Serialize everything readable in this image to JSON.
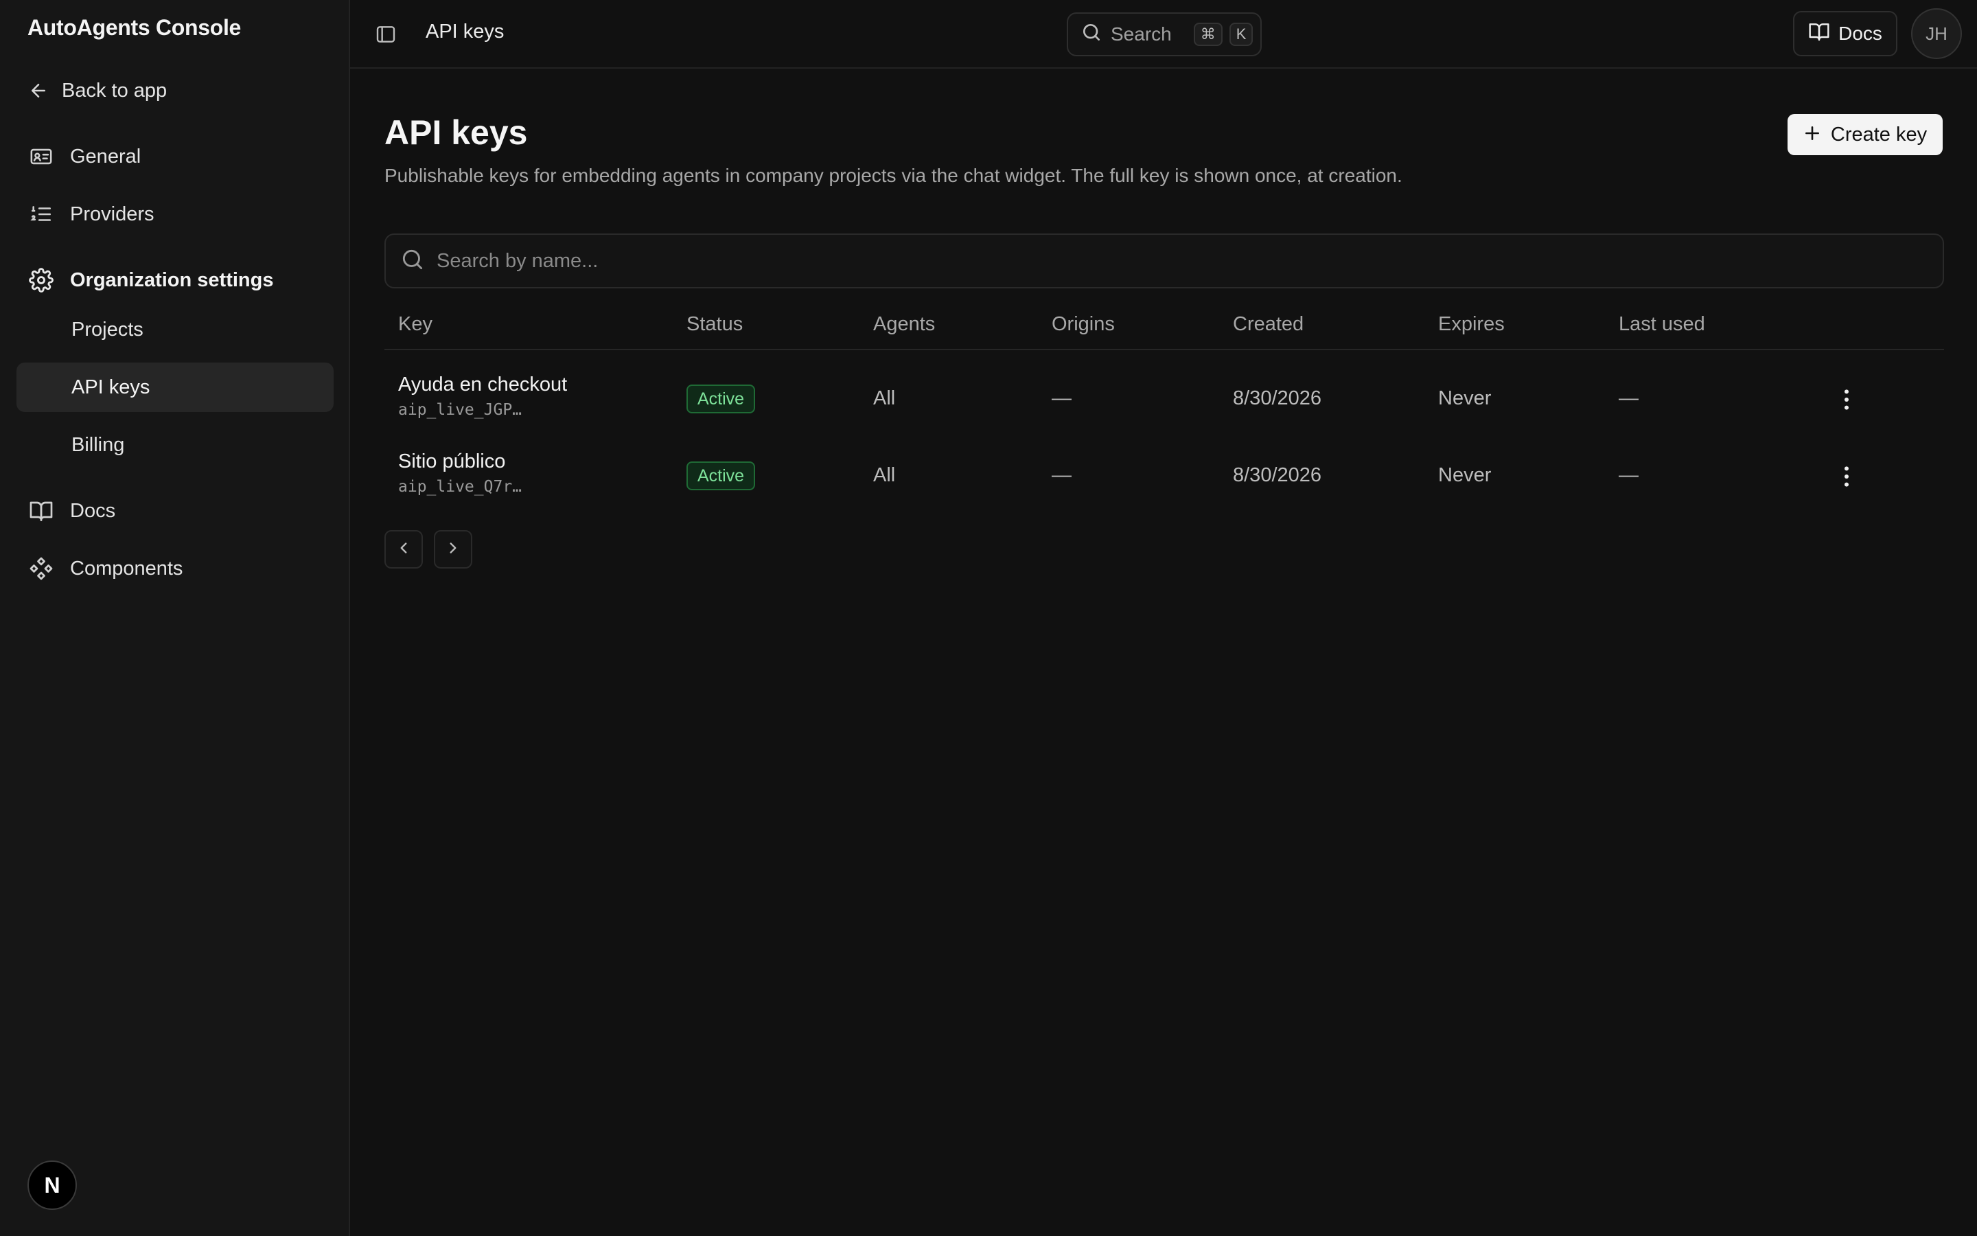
{
  "app": {
    "title": "AutoAgents Console"
  },
  "sidebar": {
    "back_label": "Back to app",
    "items": [
      {
        "label": "General",
        "icon": "id-card-icon"
      },
      {
        "label": "Providers",
        "icon": "numbered-list-icon"
      },
      {
        "label": "Organization settings",
        "icon": "gear-icon"
      },
      {
        "label": "Projects"
      },
      {
        "label": "API keys",
        "active": true
      },
      {
        "label": "Billing"
      },
      {
        "label": "Docs",
        "icon": "book-icon"
      },
      {
        "label": "Components",
        "icon": "components-icon"
      }
    ],
    "footer_badge": "N"
  },
  "topbar": {
    "breadcrumb": "API keys",
    "search_label": "Search",
    "shortcut_keys": [
      "⌘",
      "K"
    ],
    "docs_label": "Docs",
    "avatar_initials": "JH"
  },
  "main": {
    "title": "API keys",
    "description": "Publishable keys for embedding agents in company projects via the chat widget. The full key is shown once, at creation.",
    "create_button": "Create key",
    "search_placeholder": "Search by name...",
    "columns": [
      "Key",
      "Status",
      "Agents",
      "Origins",
      "Created",
      "Expires",
      "Last used"
    ],
    "rows": [
      {
        "name": "Ayuda en checkout",
        "key": "aip_live_JGP…",
        "status": "Active",
        "agents": "All",
        "origins": "—",
        "created": "8/30/2026",
        "expires": "Never",
        "last_used": "—"
      },
      {
        "name": "Sitio público",
        "key": "aip_live_Q7r…",
        "status": "Active",
        "agents": "All",
        "origins": "—",
        "created": "8/30/2026",
        "expires": "Never",
        "last_used": "—"
      }
    ]
  },
  "colors": {
    "background": "#111111",
    "sidebar": "#161616",
    "status_active": "#7ee29a",
    "primary_button": "#f4f4f4"
  }
}
